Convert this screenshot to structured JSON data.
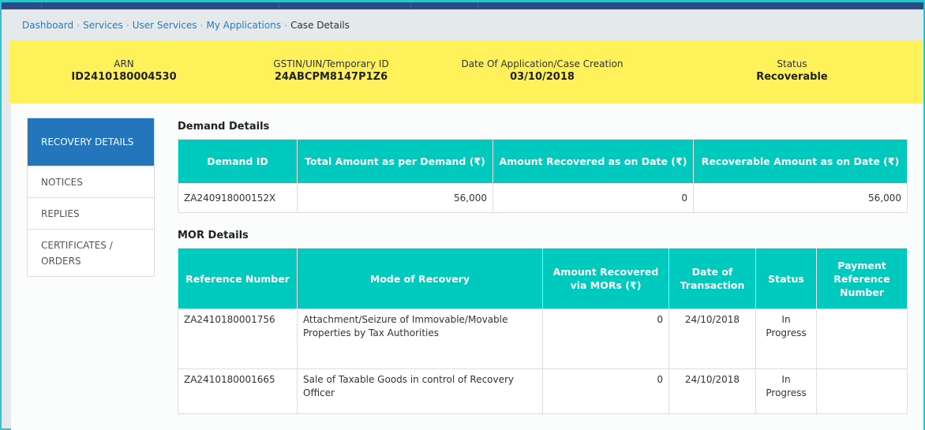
{
  "breadcrumb": [
    {
      "label": "Dashboard"
    },
    {
      "label": "Services"
    },
    {
      "label": "User Services"
    },
    {
      "label": "My Applications"
    },
    {
      "label": "Case Details"
    }
  ],
  "header": {
    "arn_label": "ARN",
    "arn_value": "ID2410180004530",
    "gstin_label": "GSTIN/UIN/Temporary ID",
    "gstin_value": "24ABCPM8147P1Z6",
    "date_label": "Date Of Application/Case Creation",
    "date_value": "03/10/2018",
    "status_label": "Status",
    "status_value": "Recoverable"
  },
  "sidebar": {
    "items": [
      {
        "label": "RECOVERY DETAILS",
        "active": true
      },
      {
        "label": "NOTICES"
      },
      {
        "label": "REPLIES"
      },
      {
        "label": "CERTIFICATES / ORDERS"
      }
    ]
  },
  "demand": {
    "title": "Demand Details",
    "columns": [
      "Demand ID",
      "Total Amount as per Demand (₹)",
      "Amount Recovered as on Date (₹)",
      "Recoverable Amount as on Date (₹)"
    ],
    "rows": [
      {
        "demand_id": "ZA240918000152X",
        "total": "56,000",
        "recovered": "0",
        "recoverable": "56,000"
      }
    ]
  },
  "mor": {
    "title": "MOR Details",
    "columns": [
      "Reference Number",
      "Mode of Recovery",
      "Amount Recovered via MORs (₹)",
      "Date of Transaction",
      "Status",
      "Payment Reference Number"
    ],
    "rows": [
      {
        "ref": "ZA2410180001756",
        "mode": "Attachment/Seizure of Immovable/Movable Properties by Tax Authorities",
        "amount": "0",
        "date": "24/10/2018",
        "status": "In Progress",
        "payment_ref": ""
      },
      {
        "ref": "ZA2410180001665",
        "mode": "Sale of Taxable Goods in control of Recovery Officer",
        "amount": "0",
        "date": "24/10/2018",
        "status": "In Progress",
        "payment_ref": ""
      }
    ]
  },
  "colors": {
    "topbar": "#2b4a86",
    "header_yellow": "#fff15a",
    "table_header": "#00c9bd",
    "active_nav": "#2376bc",
    "link": "#2a7bbd",
    "frame_border": "#26c6d0"
  }
}
